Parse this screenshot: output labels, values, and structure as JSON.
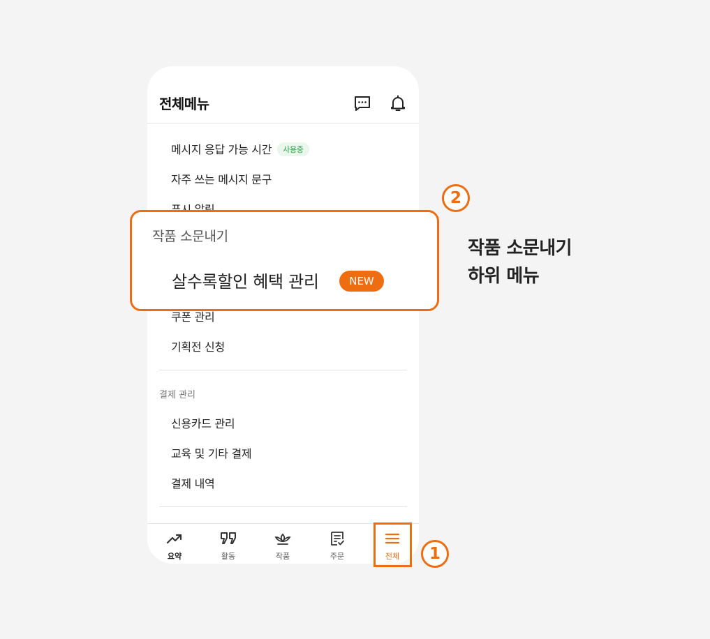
{
  "header": {
    "title": "전체메뉴",
    "chat_icon": "chat-icon",
    "bell_icon": "bell-icon"
  },
  "menu": {
    "items_top": [
      {
        "label": "메시지 응답 가능 시간",
        "badge": "사용중"
      },
      {
        "label": "자주 쓰는 메시지 문구"
      },
      {
        "label": "푸시 알림"
      }
    ],
    "items_bottom": [
      {
        "label": "쿠폰 관리"
      },
      {
        "label": "기획전 신청"
      }
    ],
    "payment_section": {
      "label": "결제 관리",
      "items": [
        "신용카드 관리",
        "교육 및 기타 결제",
        "결제 내역"
      ]
    }
  },
  "callout": {
    "section_title": "작품 소문내기",
    "item_label": "살수록할인 혜택 관리",
    "badge": "NEW"
  },
  "tabbar": [
    {
      "label": "요약",
      "icon": "trend-icon"
    },
    {
      "label": "활동",
      "icon": "quote-icon"
    },
    {
      "label": "작품",
      "icon": "plant-icon"
    },
    {
      "label": "주문",
      "icon": "order-icon"
    },
    {
      "label": "전체",
      "icon": "menu-icon",
      "active": true
    }
  ],
  "markers": {
    "one": "1",
    "two": "2"
  },
  "side_note": {
    "line1": "작품 소문내기",
    "line2": "하위 메뉴"
  },
  "colors": {
    "accent": "#ef6d11",
    "badge_green_text": "#2f9e4b",
    "background": "#f4f4f4"
  }
}
